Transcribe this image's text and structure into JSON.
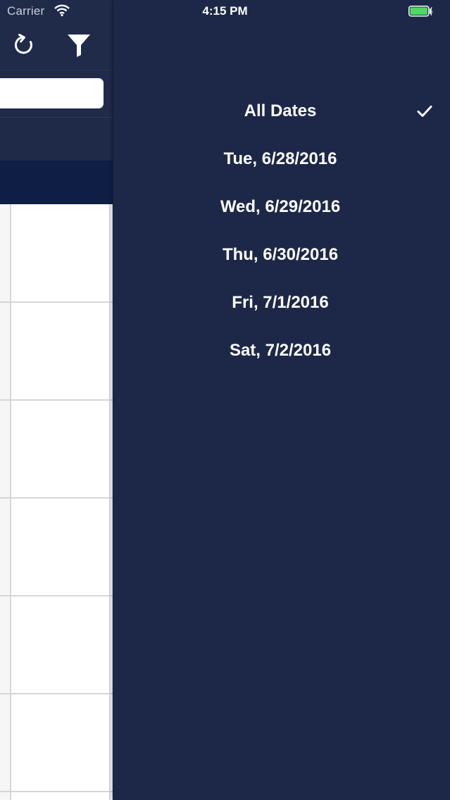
{
  "status_bar": {
    "carrier": "Carrier",
    "time": "4:15 PM",
    "battery_color": "#4cd964"
  },
  "left_panel": {
    "header_color": "#202b49",
    "column_header_color": "#0f1e44",
    "refresh_icon": "refresh-icon",
    "filter_icon": "filter-icon"
  },
  "drawer": {
    "background": "#1d2848",
    "items": [
      {
        "label": "All Dates",
        "selected": true
      },
      {
        "label": "Tue, 6/28/2016",
        "selected": false
      },
      {
        "label": "Wed, 6/29/2016",
        "selected": false
      },
      {
        "label": "Thu, 6/30/2016",
        "selected": false
      },
      {
        "label": "Fri, 7/1/2016",
        "selected": false
      },
      {
        "label": "Sat, 7/2/2016",
        "selected": false
      }
    ]
  }
}
